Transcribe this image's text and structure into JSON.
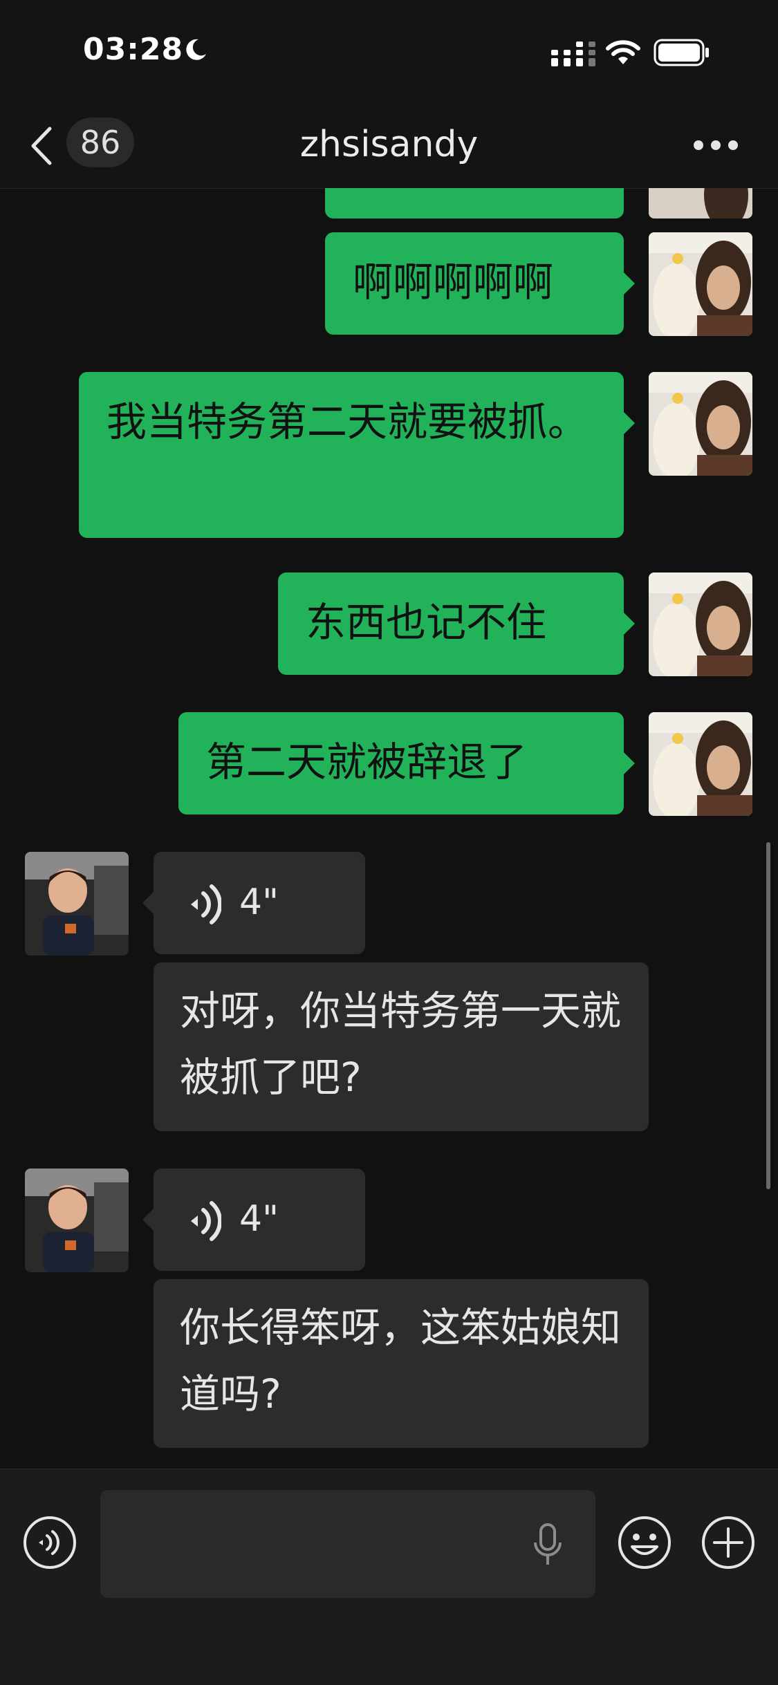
{
  "status_bar": {
    "time": "03:28"
  },
  "header": {
    "unread_count": "86",
    "title": "zhsisandy"
  },
  "messages": [
    {
      "from": "me",
      "type": "text",
      "text": "啊啊啊啊啊"
    },
    {
      "from": "me",
      "type": "text",
      "text": "我当特务第二天就要被抓。"
    },
    {
      "from": "me",
      "type": "text",
      "text": "东西也记不住"
    },
    {
      "from": "me",
      "type": "text",
      "text": "第二天就被辞退了"
    },
    {
      "from": "other",
      "type": "voice",
      "duration": "4\"",
      "transcript": "对呀，你当特务第一天就被抓了吧?"
    },
    {
      "from": "other",
      "type": "voice",
      "duration": "4\"",
      "transcript": "你长得笨呀，这笨姑娘知道吗?"
    }
  ],
  "input": {
    "value": ""
  },
  "colors": {
    "outgoing_bubble": "#21b25a",
    "incoming_bubble": "#2c2c2c",
    "background": "#111111"
  },
  "icons": [
    "moon-icon",
    "signal-icon",
    "wifi-icon",
    "battery-icon",
    "back-icon",
    "more-icon",
    "voice-wave-icon",
    "voice-input-icon",
    "mic-icon",
    "emoji-icon",
    "plus-icon"
  ]
}
